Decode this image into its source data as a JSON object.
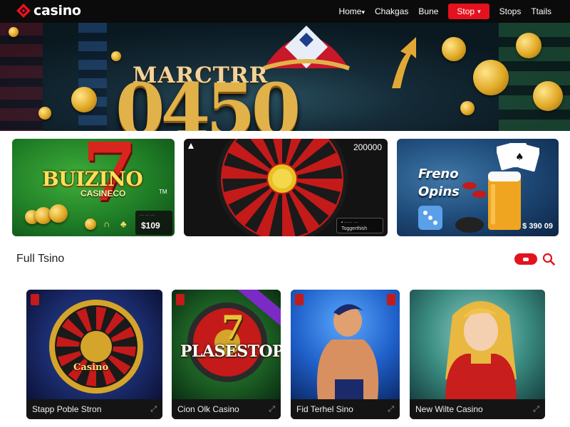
{
  "header": {
    "logo_text": "casino",
    "nav": [
      {
        "label": "Home",
        "chevron": "▾"
      },
      {
        "label": "Chakgas"
      },
      {
        "label": "Bune"
      },
      {
        "label": "Stop",
        "chevron": "▾",
        "active": true
      },
      {
        "label": "Stops"
      },
      {
        "label": "Ttails"
      }
    ]
  },
  "hero": {
    "title": "MARCTRR",
    "number": "0450"
  },
  "features": [
    {
      "title": "BUIZINO",
      "subtitle": "CASINECO",
      "mark": "TM",
      "price": "$109"
    },
    {
      "amount": "200000",
      "note": "Toggerthish"
    },
    {
      "title": "Freno Opins",
      "price": "$ 390 09"
    }
  ],
  "section": {
    "title": "Full Tsino"
  },
  "games": [
    {
      "name": "Stapp Poble Stron",
      "sign": "Casino"
    },
    {
      "name": "Cion Olk Casino",
      "sign": "PLASESTOP"
    },
    {
      "name": "Fid Terhel Sino"
    },
    {
      "name": "New Wilte Casino"
    }
  ],
  "colors": {
    "accent": "#e4121e",
    "topbar": "#0b0b0b",
    "tile_footer": "#141414"
  },
  "icons": {
    "logo": "casino-logo-icon",
    "search": "search-icon",
    "expand": "expand-icon"
  }
}
